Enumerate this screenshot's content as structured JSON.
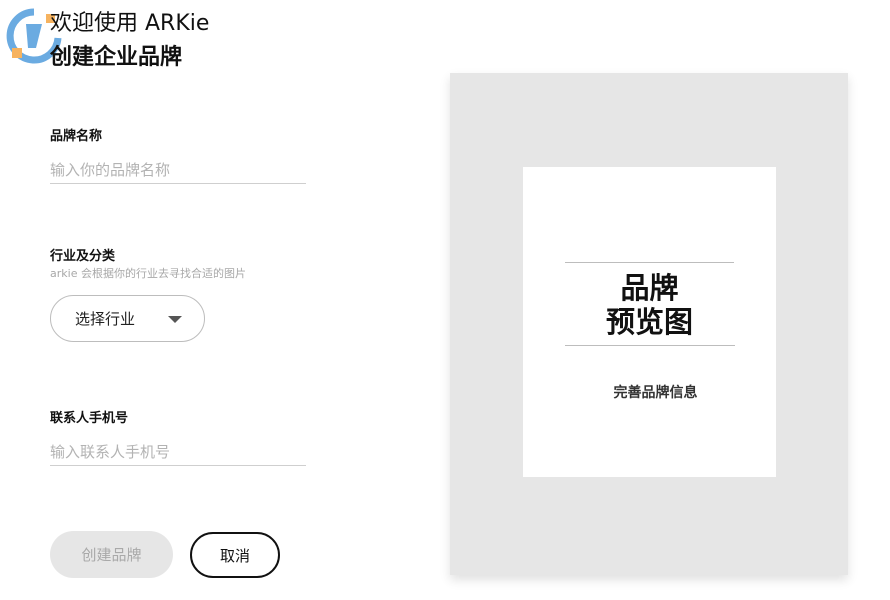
{
  "header": {
    "welcome": "欢迎使用 ARKie",
    "subtitle": "创建企业品牌"
  },
  "form": {
    "brand_name": {
      "label": "品牌名称",
      "placeholder": "输入你的品牌名称",
      "value": ""
    },
    "industry": {
      "label": "行业及分类",
      "hint": "arkie 会根据你的行业去寻找合适的图片",
      "selected": "选择行业",
      "icon": "caret-down-icon"
    },
    "phone": {
      "label": "联系人手机号",
      "placeholder": "输入联系人手机号",
      "value": ""
    },
    "actions": {
      "create_label": "创建品牌",
      "cancel_label": "取消"
    }
  },
  "preview": {
    "title_line1": "品牌",
    "title_line2": "预览图",
    "caption": "完善品牌信息"
  },
  "colors": {
    "panel_bg": "#e6e6e6",
    "disabled_button_bg": "#e6e6e6",
    "disabled_button_text": "#a9a9a9",
    "logo_blue": "#3a8fd8",
    "logo_orange": "#f39a2b"
  }
}
